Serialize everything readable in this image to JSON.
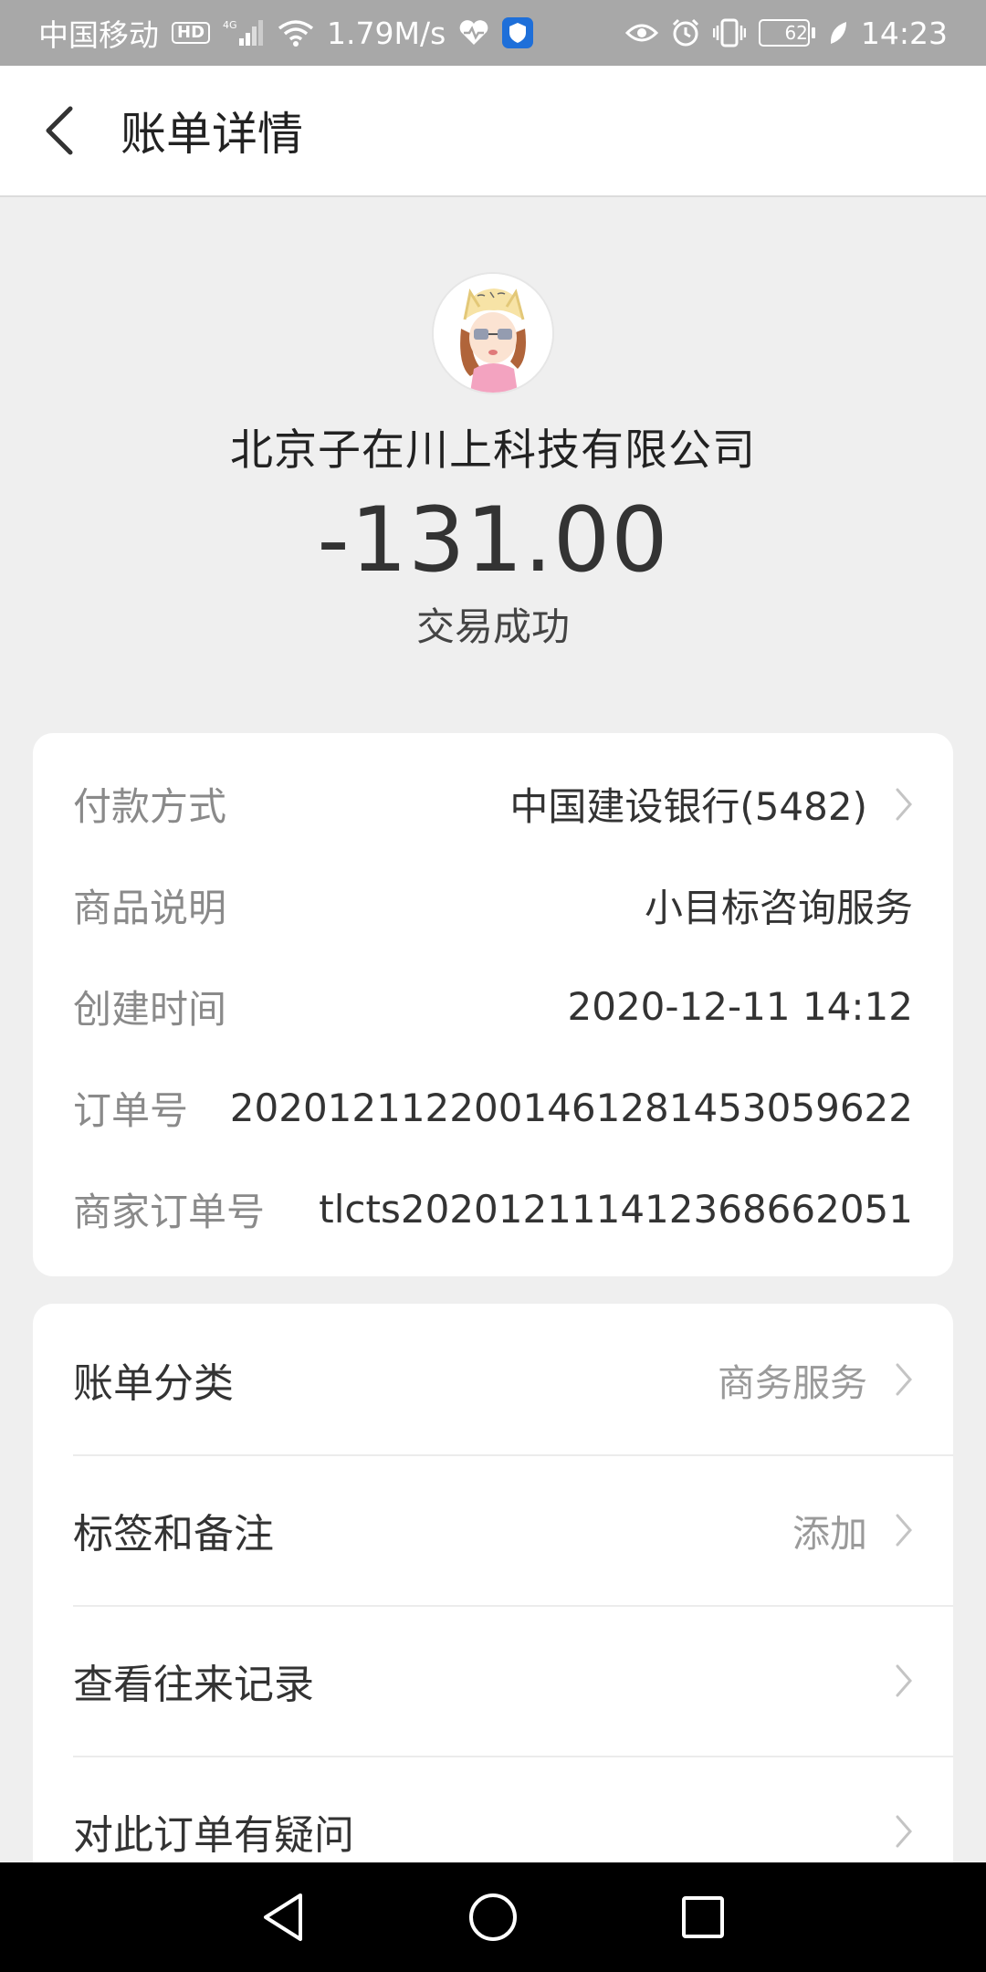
{
  "status_bar": {
    "carrier": "中国移动",
    "hd_badge": "HD",
    "network_type": "4G",
    "speed": "1.79M/s",
    "battery_percent": 62,
    "battery_label": "62",
    "time": "14:23",
    "icons": [
      "hd-icon",
      "signal-icon",
      "wifi-icon",
      "heart-pulse-icon",
      "shield-icon",
      "eye-icon",
      "alarm-icon",
      "vibrate-icon",
      "battery-icon",
      "leaf-icon"
    ]
  },
  "header": {
    "title": "账单详情",
    "back_icon": "chevron-left-icon"
  },
  "summary": {
    "merchant": "北京子在川上科技有限公司",
    "amount": "-131.00",
    "status": "交易成功"
  },
  "details": [
    {
      "label": "付款方式",
      "value": "中国建设银行(5482)",
      "has_chevron": true
    },
    {
      "label": "商品说明",
      "value": "小目标咨询服务",
      "has_chevron": false
    },
    {
      "label": "创建时间",
      "value": "2020-12-11 14:12",
      "has_chevron": false
    },
    {
      "label": "订单号",
      "value": "2020121122001461281453059622",
      "has_chevron": false
    },
    {
      "label": "商家订单号",
      "value": "tlcts2020121114123686620​51",
      "has_chevron": false
    }
  ],
  "actions": [
    {
      "label": "账单分类",
      "value": "商务服务"
    },
    {
      "label": "标签和备注",
      "value": "添加"
    },
    {
      "label": "查看往来记录",
      "value": ""
    },
    {
      "label": "对此订单有疑问",
      "value": ""
    }
  ],
  "colors": {
    "status_bar_bg": "#a8a8a8",
    "page_bg": "#efefef",
    "card_bg": "#ffffff",
    "label_gray": "#8a8a8a",
    "text_dark": "#333333",
    "shield_blue": "#1e6fd9",
    "nav_bar_bg": "#000000"
  }
}
